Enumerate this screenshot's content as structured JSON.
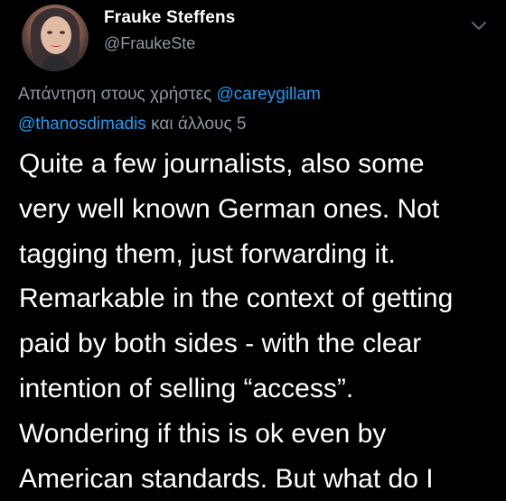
{
  "author": {
    "name": "Frauke Steffens",
    "handle": "@FraukeSte"
  },
  "reply_context": {
    "prefix": "Απάντηση στους χρήστες",
    "mention_1": "@careygillam",
    "mention_2": "@thanosdimadis",
    "suffix": "και άλλους 5"
  },
  "tweet": {
    "lines": [
      "Quite a few journalists, also some",
      "very well known German ones. Not",
      "tagging them, just forwarding it.",
      "Remarkable in the context of getting",
      "paid by both sides - with the clear",
      "intention of selling “access”.",
      "Wondering if this is ok even by",
      "American standards. But what do I"
    ]
  },
  "colors": {
    "background": "#000000",
    "name_text": "#ffffff",
    "secondary_text": "#8b98a5",
    "mention": "#1d9bf0"
  },
  "icons": {
    "more": "chevron-down-icon",
    "avatar": "user-avatar"
  }
}
